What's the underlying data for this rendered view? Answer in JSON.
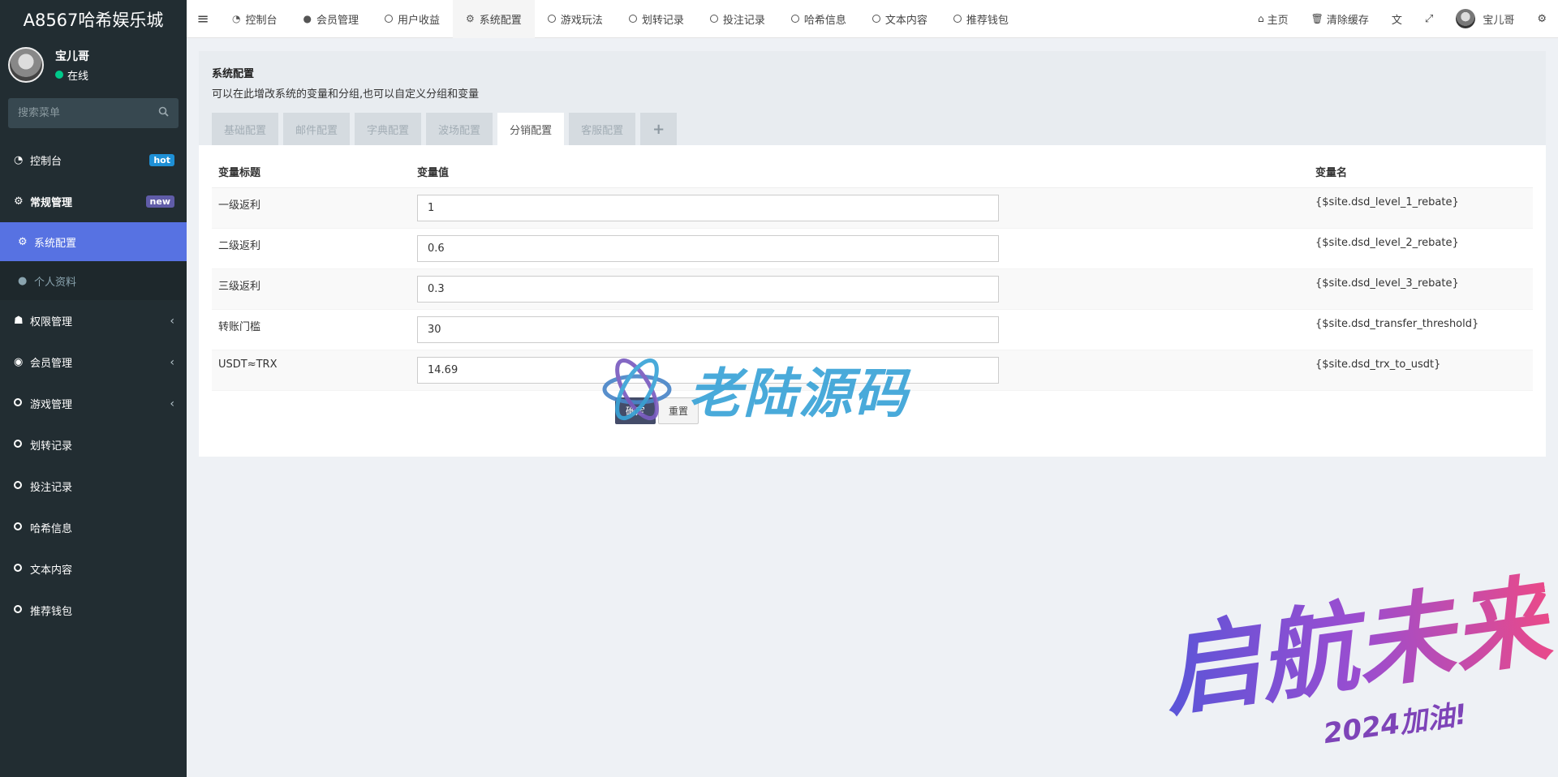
{
  "sidebar": {
    "app_title": "A8567哈希娱乐城",
    "user_name": "宝儿哥",
    "user_status": "在线",
    "search_placeholder": "搜索菜单",
    "items": [
      {
        "label": "控制台",
        "badge": "hot"
      },
      {
        "label": "常规管理",
        "badge": "new"
      },
      {
        "label": "系统配置"
      },
      {
        "label": "个人资料"
      },
      {
        "label": "权限管理"
      },
      {
        "label": "会员管理"
      },
      {
        "label": "游戏管理"
      },
      {
        "label": "划转记录"
      },
      {
        "label": "投注记录"
      },
      {
        "label": "哈希信息"
      },
      {
        "label": "文本内容"
      },
      {
        "label": "推荐钱包"
      }
    ]
  },
  "topbar": {
    "tabs": [
      "控制台",
      "会员管理",
      "用户收益",
      "系统配置",
      "游戏玩法",
      "划转记录",
      "投注记录",
      "哈希信息",
      "文本内容",
      "推荐钱包"
    ],
    "home": "主页",
    "clear_cache": "清除缓存",
    "user_name": "宝儿哥"
  },
  "panel": {
    "title": "系统配置",
    "description": "可以在此增改系统的变量和分组,也可以自定义分组和变量",
    "tabs": [
      "基础配置",
      "邮件配置",
      "字典配置",
      "波场配置",
      "分销配置",
      "客服配置",
      "+"
    ]
  },
  "table": {
    "headers": [
      "变量标题",
      "变量值",
      "变量名"
    ],
    "rows": [
      {
        "title": "一级返利",
        "value": "1",
        "name": "{$site.dsd_level_1_rebate}"
      },
      {
        "title": "二级返利",
        "value": "0.6",
        "name": "{$site.dsd_level_2_rebate}"
      },
      {
        "title": "三级返利",
        "value": "0.3",
        "name": "{$site.dsd_level_3_rebate}"
      },
      {
        "title": "转账门槛",
        "value": "30",
        "name": "{$site.dsd_transfer_threshold}"
      },
      {
        "title": "USDT≈TRX",
        "value": "14.69",
        "name": "{$site.dsd_trx_to_usdt}"
      }
    ]
  },
  "buttons": {
    "submit": "确定",
    "reset": "重置"
  },
  "watermark": {
    "text": "老陆源码",
    "banner": "启航未来",
    "banner_sub": "2024加油!"
  },
  "colors": {
    "sidebar_bg": "#222d32",
    "active_menu": "#5772e2",
    "primary_button": "#444c69"
  }
}
